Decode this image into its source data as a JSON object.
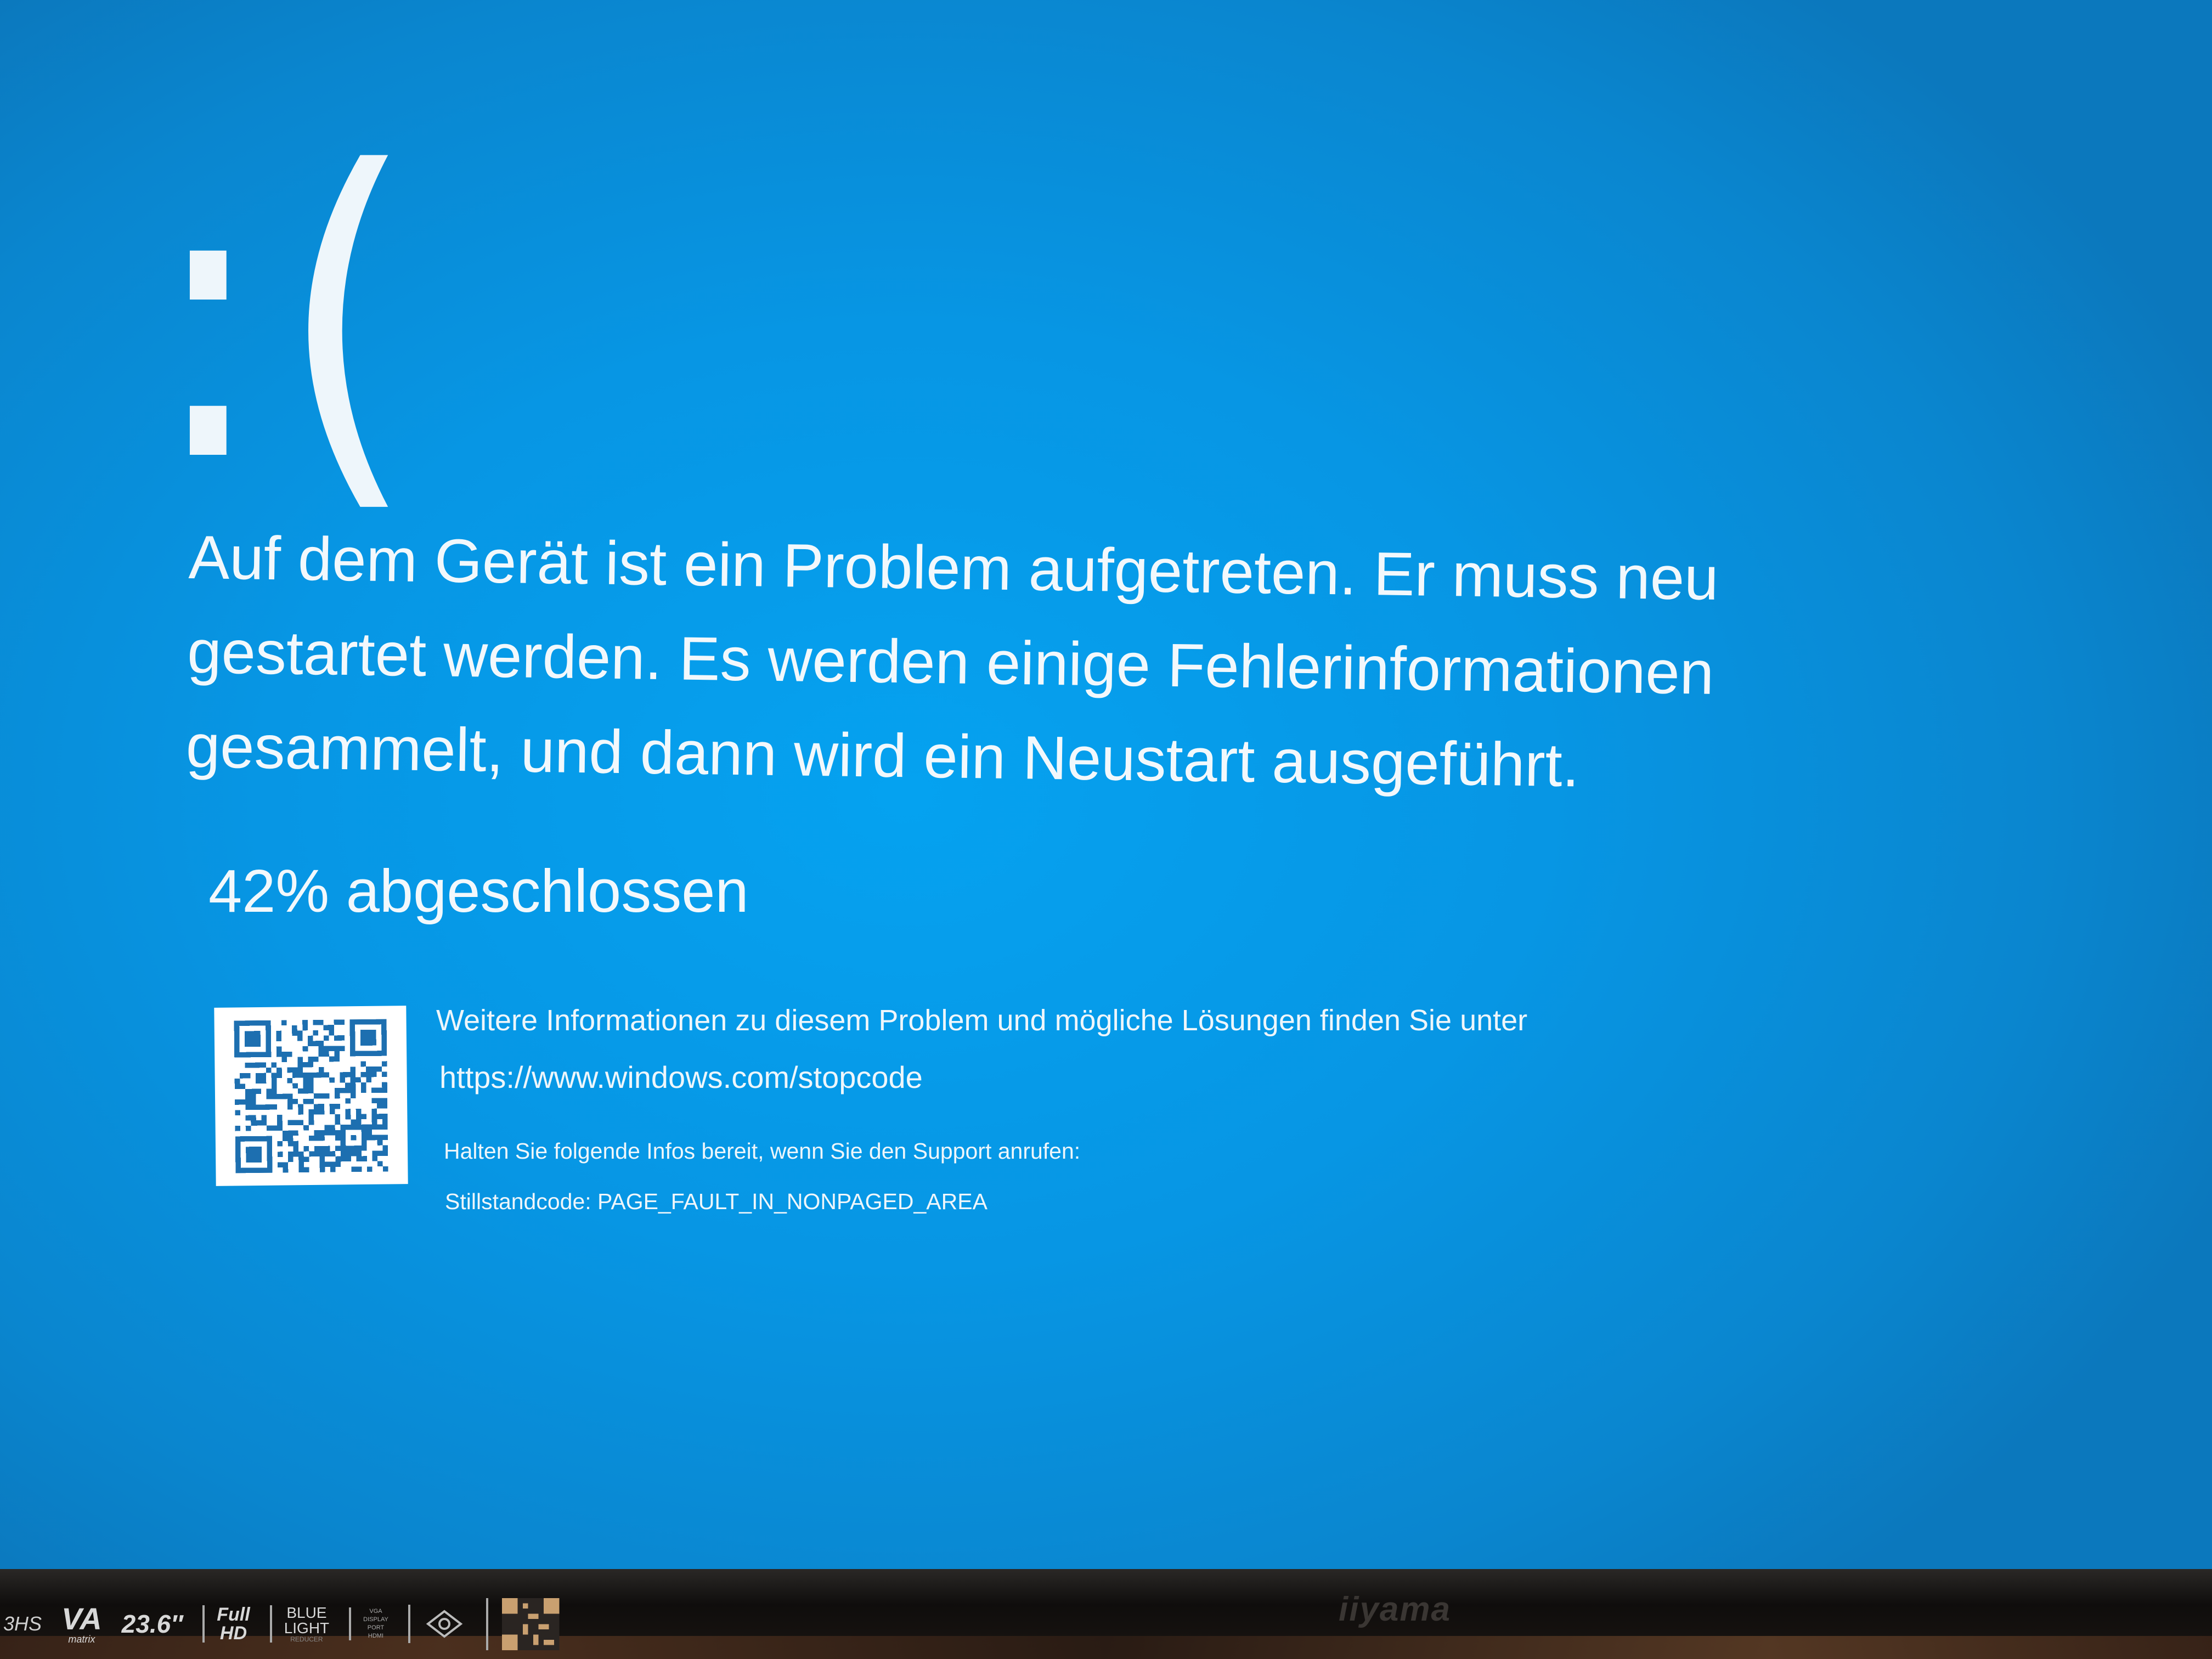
{
  "stop_screen": {
    "frown": ":(",
    "headline": "Auf dem Gerät ist ein Problem aufgetreten. Er muss neu gestartet werden. Es werden einige Fehlerinformationen gesammelt, und dann wird ein Neustart ausgeführt.",
    "progress_label": "42% abgeschlossen",
    "progress_percent": 42,
    "more_info": "Weitere Informationen zu diesem Problem und mögliche Lösungen finden Sie unter",
    "url": "https://www.windows.com/stopcode",
    "support_hint": "Halten Sie folgende Infos bereit, wenn Sie den Support anrufen:",
    "stop_code": "Stillstandcode: PAGE_FAULT_IN_NONPAGED_AREA",
    "background_color": "#0796e4",
    "text_color": "#f2f8fc"
  },
  "monitor": {
    "model_fragment": "3HS",
    "panel": "VA",
    "panel_sub": "matrix",
    "size": "23.6″",
    "hd_top": "Full",
    "hd_bottom": "HD",
    "blue_top": "BLUE",
    "blue_bottom": "LIGHT",
    "blue_sub": "REDUCER",
    "ports": [
      "VGA",
      "DISPLAY",
      "PORT",
      "HDMI"
    ],
    "brand": "iiyama"
  }
}
